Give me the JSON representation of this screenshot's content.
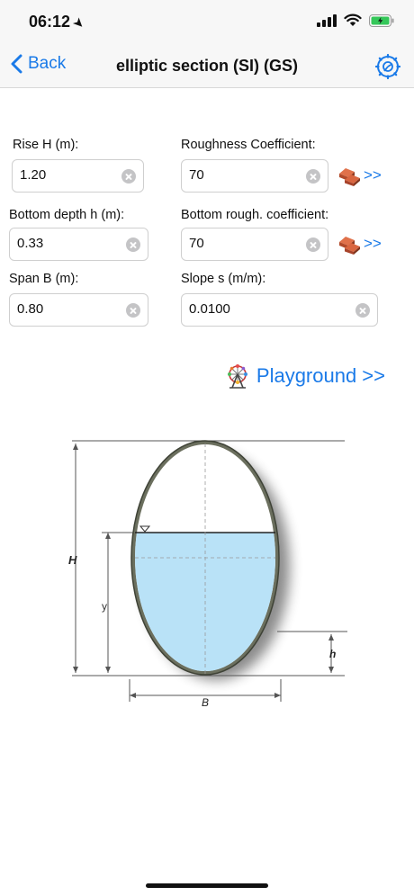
{
  "status_bar": {
    "time": "06:12"
  },
  "nav": {
    "back_label": "Back",
    "title": "elliptic section (SI) (GS)"
  },
  "form": {
    "rise": {
      "label": "Rise H (m):",
      "value": "1.20"
    },
    "roughness": {
      "label": "Roughness Coefficient:",
      "value": "70"
    },
    "bottom_depth": {
      "label": "Bottom depth h (m):",
      "value": "0.33"
    },
    "bottom_roughness": {
      "label": "Bottom rough. coefficient:",
      "value": "70"
    },
    "span": {
      "label": "Span B (m):",
      "value": "0.80"
    },
    "slope": {
      "label": "Slope s (m/m):",
      "value": "0.0100"
    },
    "bricks_link_label": ">>"
  },
  "playground": {
    "label": "Playground >>"
  },
  "diagram": {
    "label_H": "H",
    "label_y": "y",
    "label_h": "h",
    "label_B": "B"
  },
  "colors": {
    "accent": "#1a7ae8",
    "water": "#b9e2f7",
    "pipe": "#6b6f5e"
  }
}
